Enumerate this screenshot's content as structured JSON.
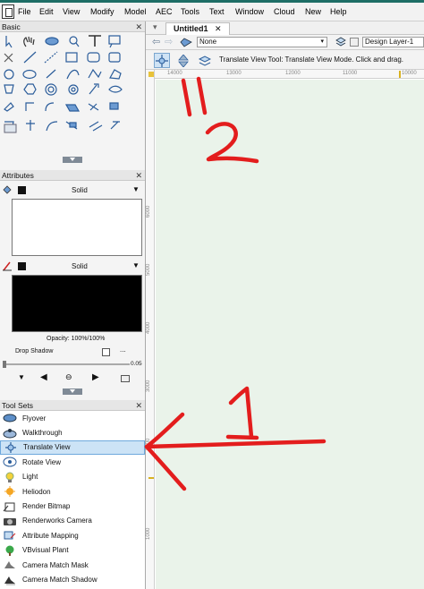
{
  "menu": [
    "File",
    "Edit",
    "View",
    "Modify",
    "Model",
    "AEC",
    "Tools",
    "Text",
    "Window",
    "Cloud",
    "New",
    "Help"
  ],
  "panels": {
    "basic_title": "Basic",
    "attributes_title": "Attributes",
    "toolsets_title": "Tool Sets",
    "close_glyph": "✕"
  },
  "attributes": {
    "fill_style": "Solid",
    "pen_style": "Solid",
    "opacity": "Opacity: 100%/100%",
    "drop_shadow": "Drop Shadow",
    "drop_shadow_more": "...",
    "thickness_value": "0.05"
  },
  "tool_sets": [
    {
      "label": "Flyover",
      "icon": "flyover-icon"
    },
    {
      "label": "Walkthrough",
      "icon": "walkthrough-icon"
    },
    {
      "label": "Translate View",
      "icon": "translate-view-icon",
      "selected": true
    },
    {
      "label": "Rotate View",
      "icon": "rotate-view-icon"
    },
    {
      "label": "Light",
      "icon": "light-icon"
    },
    {
      "label": "Heliodon",
      "icon": "heliodon-icon"
    },
    {
      "label": "Render Bitmap",
      "icon": "render-bitmap-icon"
    },
    {
      "label": "Renderworks Camera",
      "icon": "camera-icon"
    },
    {
      "label": "Attribute Mapping",
      "icon": "attribute-mapping-icon"
    },
    {
      "label": "VBvisual Plant",
      "icon": "plant-icon"
    },
    {
      "label": "Camera Match Mask",
      "icon": "camera-match-mask-icon"
    },
    {
      "label": "Camera Match Shadow",
      "icon": "camera-match-shadow-icon"
    }
  ],
  "document": {
    "tab_title": "Untitled1",
    "class_value": "None",
    "layer_value": "Design Layer-1",
    "mode_hint": "Translate View Tool: Translate View Mode. Click and drag."
  },
  "rulers": {
    "top": [
      "14000",
      "13000",
      "12000",
      "11000",
      "10000"
    ],
    "left": [
      "6000",
      "5000",
      "4000",
      "3000",
      "2000",
      "1000"
    ]
  },
  "annotations": {
    "numbers": [
      "1",
      "2",
      "1"
    ],
    "color": "#e31d1d"
  },
  "colors": {
    "selection": "#cce3f6",
    "canvas": "#eaf3ea",
    "accent": "#1e6e66"
  }
}
